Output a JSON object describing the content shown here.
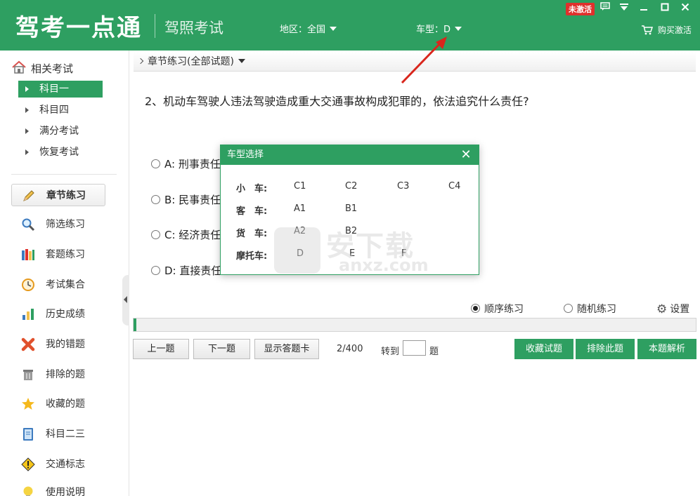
{
  "header": {
    "logo": "驾考一点通",
    "subtitle": "驾照考试",
    "region_label": "地区：全国",
    "cartype_label": "车型：D",
    "badge": "未激活",
    "buy_label": "购买激活",
    "bg_color": "#2e9f61"
  },
  "sidebar": {
    "header": "相关考试",
    "sub_items": [
      {
        "label": "科目一",
        "active": true
      },
      {
        "label": "科目四",
        "active": false
      },
      {
        "label": "满分考试",
        "active": false
      },
      {
        "label": "恢复考试",
        "active": false
      }
    ],
    "menu": [
      {
        "label": "章节练习",
        "icon": "pencil-icon",
        "active": true
      },
      {
        "label": "筛选练习",
        "icon": "magnifier-icon"
      },
      {
        "label": "套题练习",
        "icon": "books-icon"
      },
      {
        "label": "考试集合",
        "icon": "clock-icon"
      },
      {
        "label": "历史成绩",
        "icon": "bar-chart-icon"
      },
      {
        "label": "我的错题",
        "icon": "cross-icon"
      },
      {
        "label": "排除的题",
        "icon": "trash-icon"
      },
      {
        "label": "收藏的题",
        "icon": "star-icon"
      },
      {
        "label": "科目二三",
        "icon": "book-icon"
      },
      {
        "label": "交通标志",
        "icon": "warning-icon"
      },
      {
        "label": "使用说明",
        "icon": "bulb-icon"
      }
    ]
  },
  "main": {
    "breadcrumb": "章节练习(全部试题)",
    "question": "2、机动车驾驶人违法驾驶造成重大交通事故构成犯罪的，依法追究什么责任?",
    "options": [
      {
        "label": "A: 刑事责任"
      },
      {
        "label": "B: 民事责任"
      },
      {
        "label": "C: 经济责任"
      },
      {
        "label": "D: 直接责任"
      }
    ],
    "mode_sequential": "顺序练习",
    "mode_random": "随机练习",
    "settings": "设置",
    "prev": "上一题",
    "next": "下一题",
    "answer_card": "显示答题卡",
    "counter": "2/400",
    "goto_label": "转到",
    "goto_unit": "题",
    "favorite": "收藏试题",
    "exclude": "排除此题",
    "explain": "本题解析",
    "progress_fraction": 0.005
  },
  "modal": {
    "title": "车型选择",
    "rows": [
      {
        "label": "小　车:",
        "options": [
          "C1",
          "C2",
          "C3",
          "C4"
        ]
      },
      {
        "label": "客　车:",
        "options": [
          "A1",
          "B1"
        ]
      },
      {
        "label": "货　车:",
        "options": [
          "A2",
          "B2"
        ]
      },
      {
        "label": "摩托车:",
        "options": [
          "D",
          "E",
          "F"
        ]
      }
    ]
  },
  "watermark": {
    "text": "安下载",
    "url": "anxz.com"
  }
}
